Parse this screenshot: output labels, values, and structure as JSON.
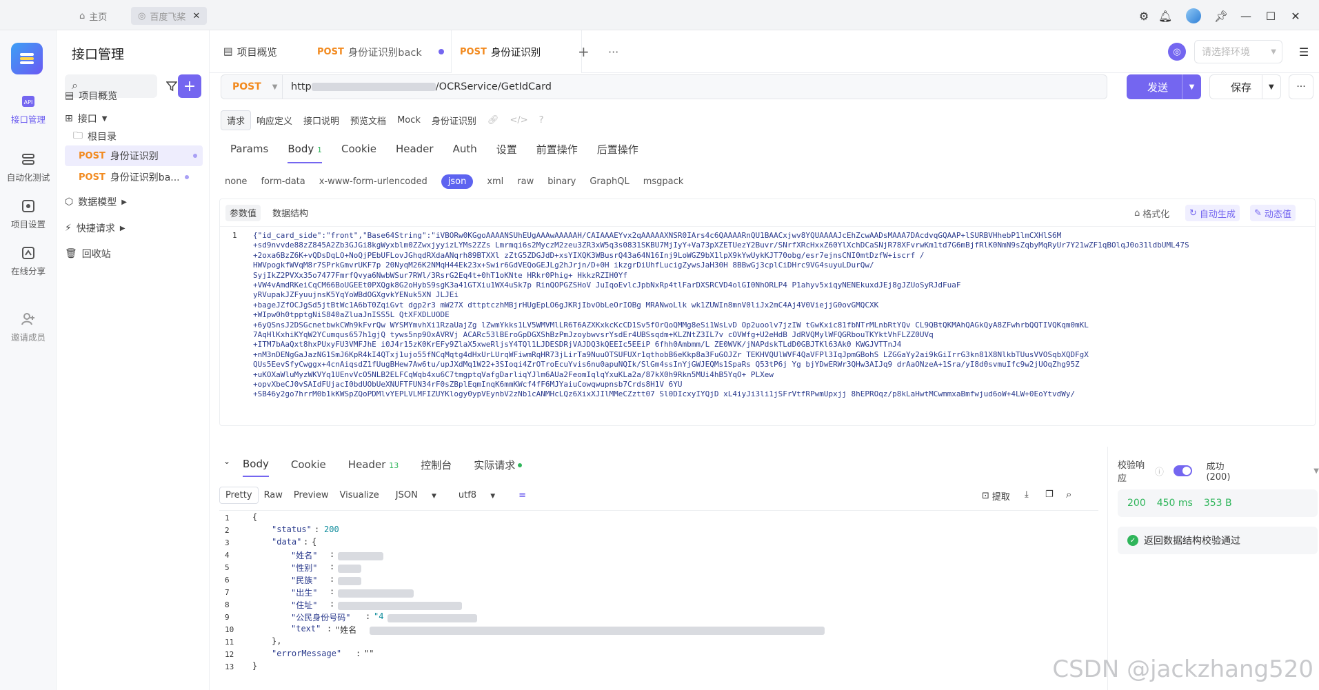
{
  "titlebar": {
    "home_label": "主页",
    "tab_label": "百度飞桨"
  },
  "rail": {
    "items": [
      {
        "label": "接口管理",
        "icon": "api-icon"
      },
      {
        "label": "自动化测试",
        "icon": "automation-icon"
      },
      {
        "label": "项目设置",
        "icon": "settings-icon"
      },
      {
        "label": "在线分享",
        "icon": "share-icon"
      },
      {
        "label": "邀请成员",
        "icon": "invite-icon"
      }
    ]
  },
  "side": {
    "title": "接口管理",
    "tree": {
      "overview": "项目概览",
      "api": "接口",
      "root": "根目录",
      "item1_method": "POST",
      "item1_name": "身份证识别",
      "item2_method": "POST",
      "item2_name": "身份证识别ba...",
      "data_model": "数据模型",
      "quick": "快捷请求",
      "trash": "回收站"
    }
  },
  "tabs": {
    "t1": "项目概览",
    "t2_method": "POST",
    "t2_name": "身份证识别back",
    "t3_method": "POST",
    "t3_name": "身份证识别",
    "env_placeholder": "请选择环境"
  },
  "request": {
    "method": "POST",
    "url_prefix": "http",
    "url_suffix": "/OCRService/GetIdCard",
    "send": "发送",
    "save": "保存",
    "subtabs": [
      "请求",
      "响应定义",
      "接口说明",
      "预览文档",
      "Mock"
    ],
    "name": "身份证识别",
    "reqtabs": [
      "Params",
      "Body",
      "Cookie",
      "Header",
      "Auth",
      "设置",
      "前置操作",
      "后置操作"
    ],
    "body_count": "1",
    "bodytypes": [
      "none",
      "form-data",
      "x-www-form-urlencoded",
      "json",
      "xml",
      "raw",
      "binary",
      "GraphQL",
      "msgpack"
    ],
    "code_tabs": [
      "参数值",
      "数据结构"
    ],
    "tools": [
      "格式化",
      "自动生成",
      "动态值"
    ],
    "line_no": "1",
    "code_lines": [
      "{\"id_card_side\":\"front\",\"Base64String\":\"iVBORw0KGgoAAAANSUhEUgAAAwAAAAAH/CAIAAAEYvx2qAAAAAXNSR0IArs4c6QAAAARnQU1BAACxjwv8YQUAAAAJcEhZcwAADsMAAA7DAcdvqGQAAP+lSURBVHhebP1lmCXHlS6M",
      "+sd9nvvde88zZ845A2Zb3GJGi8kgWyxblm0ZZwxjyyizLYMs2ZZs         Lmrmqi6s2MyczM2zeu3ZR3xW5q3s0831SKBU7MjIyY+Va73pXZETUezY2Buvr/SNrfXRcHxxZ60YlXchDCaSNjR78XFvrwKm1td7G6mBjfRlK0NmN9sZqbyMqRyUr7Y21wZF1qBOlqJ0o31ldbUML47S",
      "+2oxa6BzZ6K+vQDsDqLO+NoQjPEbUFLovJGhqdRXdaANqrh89BTXXl   zZtG5ZDGJdD+xsYIXQK3WBusrQ43a64N16Inj9LoWGZ9bX1lpX9kYwUykKJT70obg/esr7ejnsCNI0mtDzfW+iscrf              /",
      "HWVpogkfWVqM8r7SPrkGmvrUKF7p                                     20NyqM26K2NMqH44Ek23x+Swir6GdVEQoGEJLg2hJrjn/D+0H           ikzgrDiUhfLucigZywsJaH30H   8BBwGj3cplCiDHrc9VG4suyuLDurQw/",
      "SyjIkZ2PVXx35o7477FmrfQvya6NwbWSur7RWl/3RsrG2Eq4t+0hT1oKNte   HRkr0Phig+                    HkkzRZIH0Yf",
      "+VW4vAmdRKeiCqCM66BoUGEEt0PXQgk8G2oHybS9sgK3a41GTXiu1WX4uSk7p             RinQOPGZSHoV                 JuIqoEvlcJpbNxRp4tlFarDXSRCVD4olGI0NhORLP4   P1ahyv5xiqyNENEkuxdJEj8gJZUoSyRJdFuaF",
      "yRVupakJZFyuujnsK5YqYoWBdOGXgvkYENuk5XN                                                  JLJEi",
      "+bageJZfOCJgSd5jtBtWc1A6bT0ZqiGvt    dgp2r3      mW27X   dttptczhMBjrHUgEpLO6gJKRjIbvObLeOrIOBg       MRANwoLlk    wk1ZUWIn8mnV0liJx2mC4Aj4V0ViejjG0ovGMQCXK",
      "+WIpw0h0tpptgNiS840aZluaJnISS5L         QtXFXDLUODE",
      "+6yQSnsJ2DSGcnetbwkCWh9kFvrQw    WYSMYmvhXi1RzaUajZg   lZwmYkks1LV5WMVMlLR6T6AZXKxkcKcCD1Sv5fOrQoQMMg8eSi1WsLvD    Op2uoolv7jzIW       tGwKxic81fbNTrMLnbRtYQv   CL9QBtQKMAhQAGkQyA8ZFwhrbQQTIVQKqm0mKL",
      "7AqHlKxhiKYqW2YCumqus657h1gjQ  tyws5np9OxAVRVj   ACARc53lBEroGpDGXShBzPmJzoybwvsrYsdEr4UBSsqdm+KLZNtZ3IL7v    cOVWfg+U2eHdB   JdRVQMylWFQGRbouTKYktVhFLZZ0UVq",
      "+ITM7bAaQxt8hxPUxyFU3VMFJhE   i0J4r15zK0KrEFy9ZlaX5xweRljsY4TQl1LJDESDRjVAJDQ3kQEEIc5EEiP     6fhh0Ambmm/L   ZE0WVK/jNAPdskTLdD0GBJTKl63Ak0    KWGJVTTnJ4",
      "+nM3nDENgGaJazNG1SmJ6KpR4kI4QTxj1ujo55fNCqMqtg4dHxUrLUrqWFiwmRqHR73jLirTa9NuuOTSUFUXr1qthobB6eKkp8a3FuGOJZr   TEKHVQUlWVF4QaVFPl3IqJpmGBohS    LZGGaYy2ai9kGiIrrG3kn81X8NlkbTUusVVOSqbXQDFgX",
      "QUs5EevSfyCwggx+4cnAiqsdZ1fUugBHew7Aw6tu/upJXdMq1W22+3SIoqi4ZrOTroEcuYvis6nu0apuNQIk/SlGm4ssInYjGWJEQMs1SpaRs   Q53tP6j   Yg   bjYDwERWr3QHw3AIJq9   drAaONzeA+1Sra/yI8d0svmuIfc9w2jUOqZhg95Z",
      "+uKOXaWluMyzWKVYq1UEnvVcO5NLB2ELFCqWqb4xu6C7tmgptqVafgDarliqYJlm6AUa2FeomIqlqYxuKLa2a/87kX0h9Rkn5MUi4hB5YqO+                   PLXew",
      "+opvXbeCJ0vSAIdFUjacI0bdUObUeXNUFTFUN34rF0sZBplEqmInqK6mmKWcf4fF6MJYaiuCowqwupnsb7Crds8H1V         6YU",
      "+SB46y2go7hrrM0b1kKWSpZQoPDMlvYEPLVLMFIZUYKlogy0ypVEynbV2zNb1cANMHcLQz6XixXJIlMMeCZztt07   Sl0DIcxyIYQjD   xL4iyJi3li1jSFrVtfRPwmUpxjj   8hEPROqz/p8kLaHwtMCwmmxaBmfwjud6oW+4LW+0EoYtvdWy/"
    ]
  },
  "response": {
    "tabs": [
      "Body",
      "Cookie",
      "Header",
      "控制台",
      "实际请求"
    ],
    "header_count": "13",
    "formats": [
      "Pretty",
      "Raw",
      "Preview",
      "Visualize",
      "JSON",
      "utf8"
    ],
    "extract": "提取",
    "line_numbers": [
      "1",
      "2",
      "3",
      "4",
      "5",
      "6",
      "7",
      "8",
      "9",
      "10",
      "11",
      "12",
      "13"
    ],
    "json": {
      "open": "{",
      "status_key": "\"status\"",
      "status_val": "200",
      "data_key": "\"data\"",
      "data_open": "{",
      "f_name": "\"姓名\"",
      "f_sex": "\"性别\"",
      "f_nation": "\"民族\"",
      "f_birth": "\"出生\"",
      "f_addr": "\"住址\"",
      "f_id": "\"公民身份号码\"",
      "f_id_val_prefix": "\"4",
      "f_text": "\"text\"",
      "f_text_val_prefix": "\"姓名",
      "data_close": "},",
      "err_key": "\"errorMessage\"",
      "err_val": "\"\"",
      "close": "}"
    }
  },
  "verify": {
    "label": "校验响应",
    "result": "成功 (200)",
    "status": "200",
    "time": "450 ms",
    "size": "353 B",
    "pass_msg": "返回数据结构校验通过"
  },
  "watermark": "CSDN @jackzhang520",
  "colors": {
    "accent": "#7466f0",
    "post": "#f28a1f",
    "success": "#2fb55a"
  }
}
